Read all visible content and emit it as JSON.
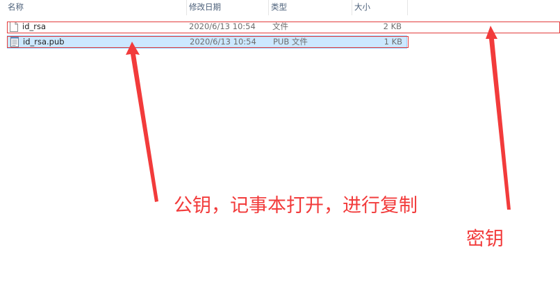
{
  "columns": {
    "name": "名称",
    "modified": "修改日期",
    "type": "类型",
    "size": "大小"
  },
  "files": [
    {
      "name": "id_rsa",
      "modified": "2020/6/13 10:54",
      "type": "文件",
      "size": "2 KB",
      "icon": "blank-file-icon"
    },
    {
      "name": "id_rsa.pub",
      "modified": "2020/6/13 10:54",
      "type": "PUB 文件",
      "size": "1 KB",
      "icon": "text-file-icon",
      "selected": true
    }
  ],
  "annotations": {
    "public_key_note": "公钥，记事本打开，进行复制",
    "private_key_note": "密钥"
  },
  "colors": {
    "annotation_red": "#f23b3b",
    "selection_bg": "#cce8ff",
    "selection_border": "#99d1ff",
    "header_text": "#4c607a"
  }
}
